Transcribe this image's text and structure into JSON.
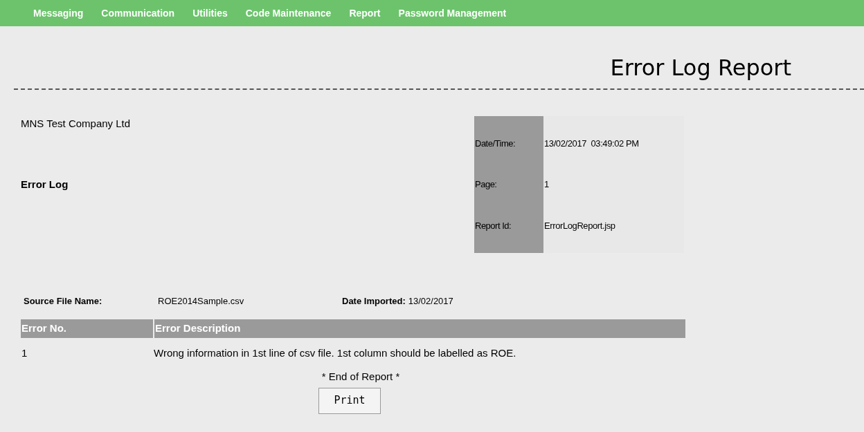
{
  "nav": [
    "Messaging",
    "Communication",
    "Utilities",
    "Code Maintenance",
    "Report",
    "Password Management"
  ],
  "title": "Error Log Report",
  "company": "MNS Test Company Ltd",
  "section": "Error Log",
  "info": [
    {
      "label": "Date/Time:",
      "value": "13/02/2017  03:49:02 PM"
    },
    {
      "label": "Page:",
      "value": "1"
    },
    {
      "label": "Report Id:",
      "value": "ErrorLogReport.jsp"
    }
  ],
  "source_file": {
    "label": "Source File Name:",
    "value": "ROE2014Sample.csv"
  },
  "date_imported": {
    "label": "Date Imported:",
    "value": "13/02/2017"
  },
  "table": {
    "columns": [
      "Error No.",
      "Error Description"
    ],
    "rows": [
      [
        "1",
        "Wrong information in 1st line of csv file. 1st column should be labelled as ROE."
      ]
    ]
  },
  "end_note": "* End of Report *",
  "print_button": "Print"
}
